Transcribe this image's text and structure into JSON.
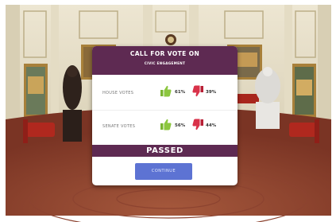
{
  "modal": {
    "title": "CALL FOR VOTE ON",
    "subtitle": "CIVIC ENGAGEMENT",
    "house": {
      "label": "HOUSE VOTES",
      "yes": "61%",
      "no": "39%"
    },
    "senate": {
      "label": "SENATE VOTES",
      "yes": "56%",
      "no": "44%"
    },
    "result": "PASSED",
    "continue_label": "CONTINUE"
  },
  "colors": {
    "header": "#5e2a52",
    "button": "#5d73d3",
    "thumb_up": "#8cc63f",
    "thumb_down": "#d9324a"
  },
  "icons": [
    "thumbs-up-icon",
    "thumbs-down-icon"
  ]
}
